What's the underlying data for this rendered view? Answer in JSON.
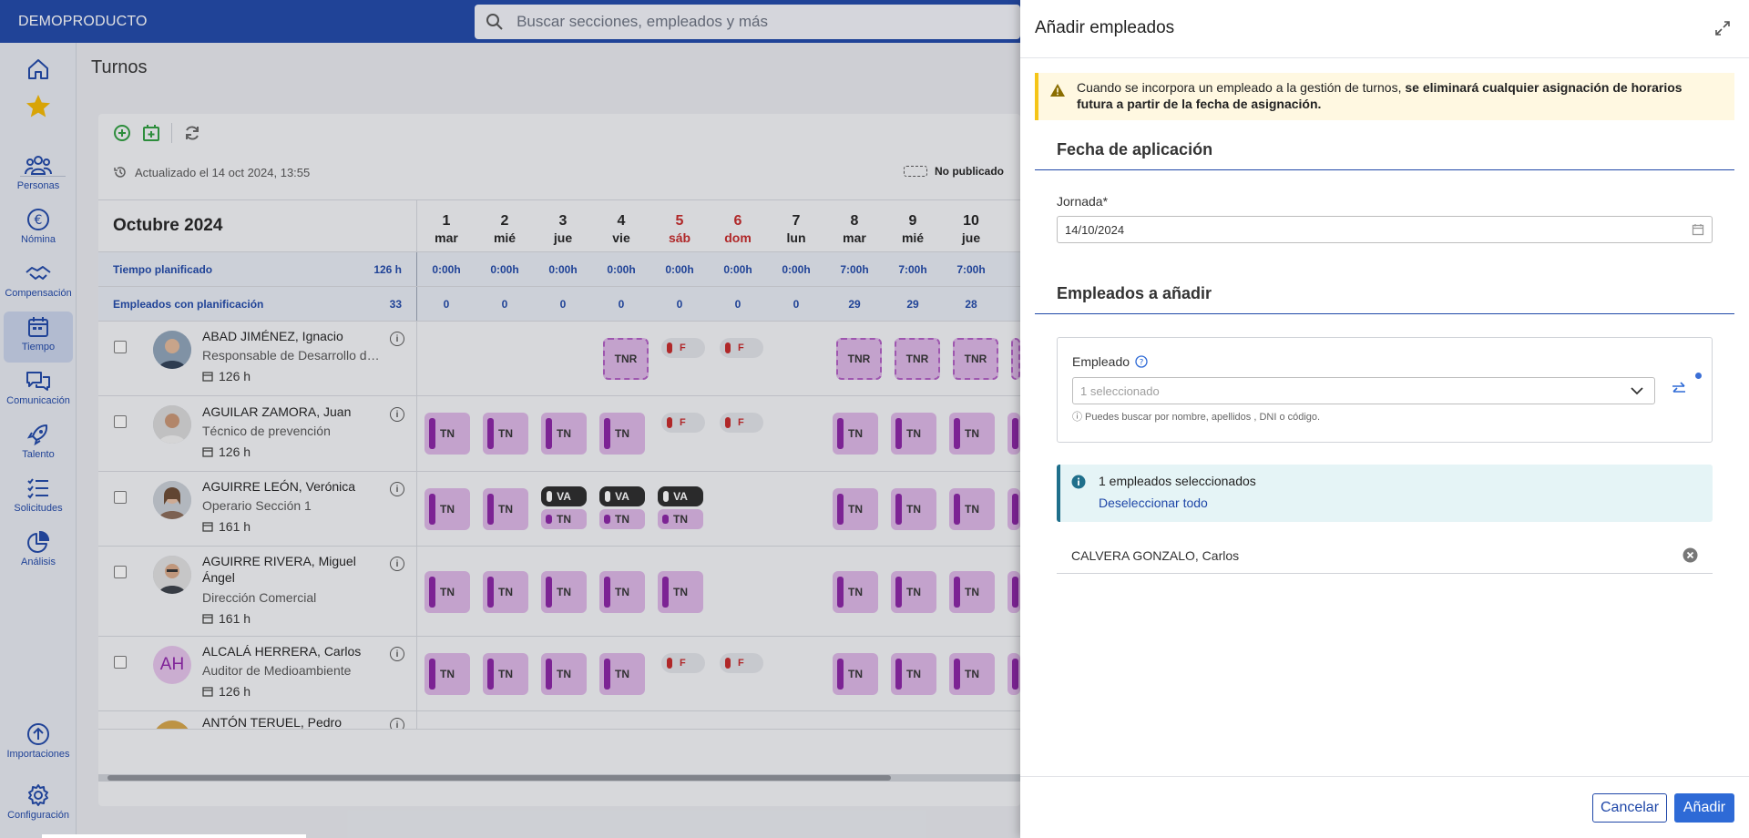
{
  "app": {
    "brand": "DEMOPRODUCTO",
    "search_placeholder": "Buscar secciones, empleados y más"
  },
  "nav": [
    {
      "label": "",
      "icon": "home-icon"
    },
    {
      "label": "",
      "icon": "star-icon"
    },
    {
      "label": "Personas",
      "icon": "people-icon"
    },
    {
      "label": "Nómina",
      "icon": "euro-icon"
    },
    {
      "label": "Compensación",
      "icon": "handshake-icon"
    },
    {
      "label": "Tiempo",
      "icon": "calendar-icon"
    },
    {
      "label": "Comunicación",
      "icon": "chat-icon"
    },
    {
      "label": "Talento",
      "icon": "rocket-icon"
    },
    {
      "label": "Solicitudes",
      "icon": "checklist-icon"
    },
    {
      "label": "Análisis",
      "icon": "pie-chart-icon"
    },
    {
      "label": "Importaciones",
      "icon": "upload-icon"
    },
    {
      "label": "Configuración",
      "icon": "gear-icon"
    }
  ],
  "page": {
    "title": "Turnos",
    "updated": "Actualizado el 14 oct 2024, 13:55",
    "legend_unpublished": "No publicado",
    "month": "Octubre 2024"
  },
  "days": [
    {
      "n": "1",
      "w": "mar"
    },
    {
      "n": "2",
      "w": "mié"
    },
    {
      "n": "3",
      "w": "jue"
    },
    {
      "n": "4",
      "w": "vie"
    },
    {
      "n": "5",
      "w": "sáb"
    },
    {
      "n": "6",
      "w": "dom"
    },
    {
      "n": "7",
      "w": "lun"
    },
    {
      "n": "8",
      "w": "mar"
    },
    {
      "n": "9",
      "w": "mié"
    },
    {
      "n": "10",
      "w": "jue"
    }
  ],
  "summary": [
    {
      "label": "Tiempo planificado",
      "total": "126 h",
      "values": [
        "0:00h",
        "0:00h",
        "0:00h",
        "0:00h",
        "0:00h",
        "0:00h",
        "0:00h",
        "7:00h",
        "7:00h",
        "7:00h"
      ]
    },
    {
      "label": "Empleados con planificación",
      "total": "33",
      "values": [
        "0",
        "0",
        "0",
        "0",
        "0",
        "0",
        "0",
        "29",
        "29",
        "28"
      ]
    }
  ],
  "employees": [
    {
      "name": "ABAD JIMÉNEZ, Ignacio",
      "role": "Responsable de Desarrollo de...",
      "hours": "126 h",
      "initials": ""
    },
    {
      "name": "AGUILAR ZAMORA, Juan",
      "role": "Técnico de prevención",
      "hours": "126 h",
      "initials": ""
    },
    {
      "name": "AGUIRRE LEÓN, Verónica",
      "role": "Operario Sección 1",
      "hours": "161 h",
      "initials": ""
    },
    {
      "name": "AGUIRRE RIVERA, Miguel Ángel",
      "role": "Dirección Comercial",
      "hours": "161 h",
      "initials": ""
    },
    {
      "name": "ALCALÁ HERRERA, Carlos",
      "role": "Auditor de Medioambiente",
      "hours": "126 h",
      "initials": "AH"
    },
    {
      "name": "ANTÓN TERUEL, Pedro",
      "role": "",
      "hours": "",
      "initials": ""
    }
  ],
  "shift_labels": {
    "tn": "TN",
    "tnr": "TNR",
    "f": "F",
    "va": "VA"
  },
  "drawer": {
    "title": "Añadir empleados",
    "warning_normal": "Cuando se incorpora un empleado a la gestión de turnos, ",
    "warning_bold": "se eliminará cualquier asignación de horarios futura a partir de la fecha de asignación.",
    "section1": "Fecha de aplicación",
    "jornada_label": "Jornada*",
    "jornada_value": "14/10/2024",
    "section2": "Empleados a añadir",
    "empleado_label": "Empleado",
    "empleado_placeholder": "1 seleccionado",
    "help": "ⓘ Puedes buscar por nombre, apellidos , DNI o código.",
    "selected_count": "1 empleados seleccionados",
    "deselect_all": "Deseleccionar todo",
    "selected_employee": "CALVERA GONZALO, Carlos",
    "cancel": "Cancelar",
    "add": "Añadir"
  }
}
